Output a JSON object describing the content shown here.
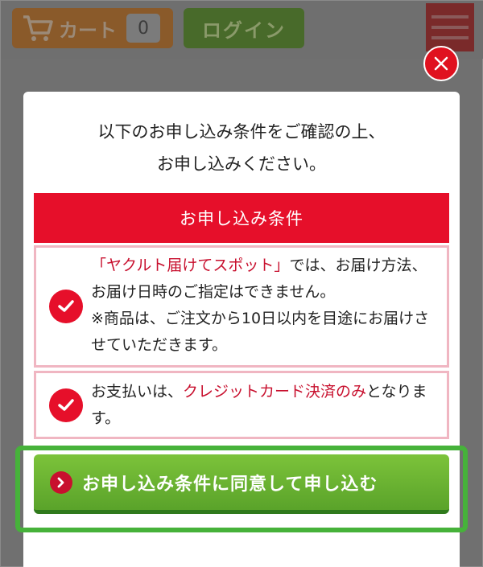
{
  "header": {
    "cart_label": "カート",
    "cart_count": "0",
    "login_label": "ログイン"
  },
  "modal": {
    "intro_line1": "以下のお申し込み条件をご確認の上、",
    "intro_line2": "お申し込みください。",
    "conditions_title": "お申し込み条件",
    "condition1": {
      "highlight": "「ヤクルト届けてスポット」",
      "text_a": "では、お届け方法、お届け日時のご指定はできません。",
      "text_b": "※商品は、ご注文から10日以内を目途にお届けさせていただきます。"
    },
    "condition2": {
      "prefix": "お支払いは、",
      "highlight": "クレジットカード決済のみ",
      "suffix": "となります。"
    },
    "agree_label": "お申し込み条件に同意して申し込む"
  },
  "colors": {
    "accent_red": "#e60f2a",
    "agree_green": "#5aa32a",
    "highlight_frame": "#46b23a"
  }
}
